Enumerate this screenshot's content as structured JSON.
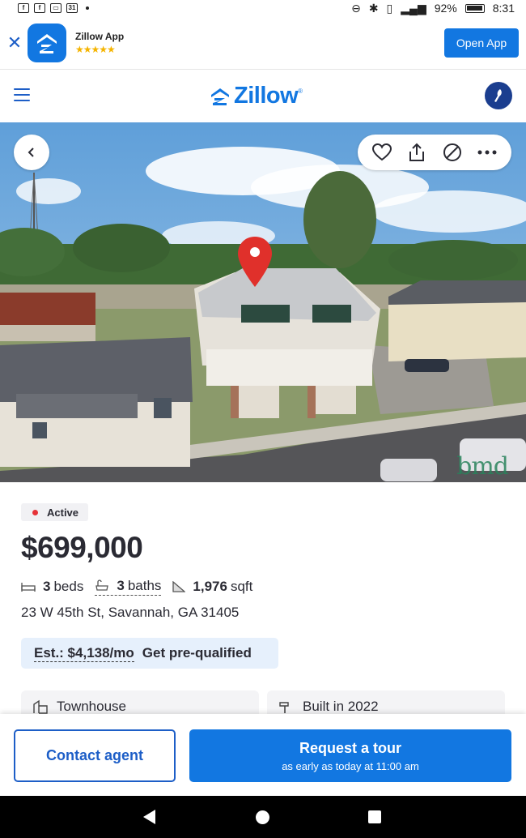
{
  "status_bar": {
    "time": "8:31",
    "battery": "92%",
    "calendar_day": "31",
    "left_icons": [
      "facebook-icon",
      "facebook-icon",
      "bed-icon",
      "calendar-icon",
      "dot-icon"
    ],
    "right_icons": [
      "sync-icon",
      "bluetooth-icon",
      "vibrate-icon",
      "signal-icon",
      "battery-icon"
    ]
  },
  "app_banner": {
    "title": "Zillow App",
    "rating": "★★★★★",
    "open_label": "Open App",
    "close_icon": "close-icon"
  },
  "header": {
    "logo_text": "Zillow",
    "logo_mark": "®",
    "menu_icon": "hamburger-menu-icon",
    "avatar_icon": "user-avatar-icon"
  },
  "photo": {
    "watermark": "bmd",
    "actions": [
      "heart-icon",
      "share-icon",
      "hide-icon",
      "more-icon"
    ],
    "back_icon": "chevron-left-icon"
  },
  "listing": {
    "status": "Active",
    "price": "$699,000",
    "beds_value": "3",
    "beds_label": "beds",
    "baths_value": "3",
    "baths_label": "baths",
    "sqft_value": "1,976",
    "sqft_label": "sqft",
    "address": "23 W 45th St, Savannah, GA 31405",
    "estimate_label": "Est.: $4,138/mo",
    "estimate_link": "Get pre-qualified",
    "home_type": "Townhouse",
    "built": "Built in 2022"
  },
  "actions": {
    "contact_label": "Contact agent",
    "tour_label": "Request a tour",
    "tour_sub": "as early as today at 11:00 am"
  },
  "colors": {
    "brand_blue": "#1277e1",
    "active_red": "#e63238",
    "text_dark": "#2a2a33"
  }
}
